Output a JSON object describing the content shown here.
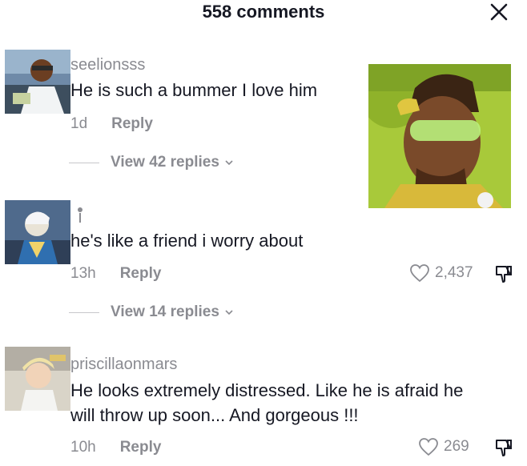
{
  "header": {
    "title": "558 comments"
  },
  "comments": [
    {
      "username": "seelionsss",
      "text": "He is such a bummer I love him",
      "time": "1d",
      "reply_label": "Reply",
      "view_replies": "View 42 replies"
    },
    {
      "username": "",
      "text": "he's like a friend i worry about",
      "time": "13h",
      "reply_label": "Reply",
      "likes": "2,437",
      "view_replies": "View 14 replies"
    },
    {
      "username": "priscillaonmars",
      "text_line1": "He looks extremely distressed. Like he is afraid he",
      "text_line2": "will throw up soon... And gorgeous !!!",
      "time": "10h",
      "reply_label": "Reply",
      "likes": "269"
    }
  ],
  "colors": {
    "text": "#161823",
    "muted": "#8a8b91",
    "sticker_bg": "#a8c93a"
  }
}
